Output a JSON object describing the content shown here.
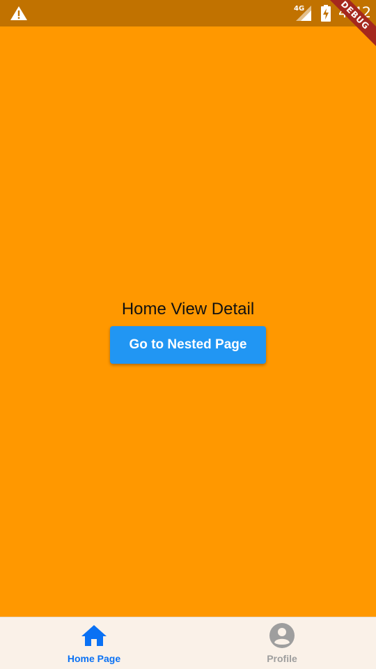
{
  "status_bar": {
    "time": "4:42",
    "network": "4G",
    "debug_banner": "DEBUG"
  },
  "main": {
    "detail_text": "Home View Detail",
    "button_label": "Go to Nested Page"
  },
  "bottom_nav": {
    "items": [
      {
        "label": "Home Page",
        "icon": "home-icon",
        "active": true
      },
      {
        "label": "Profile",
        "icon": "account-circle-icon",
        "active": false
      }
    ]
  },
  "colors": {
    "background": "#ff9800",
    "status_bar": "#c17200",
    "button": "#2196f3",
    "nav_active": "#0a71f4",
    "nav_inactive": "#9e9e9e",
    "nav_background": "#faf1e8"
  }
}
